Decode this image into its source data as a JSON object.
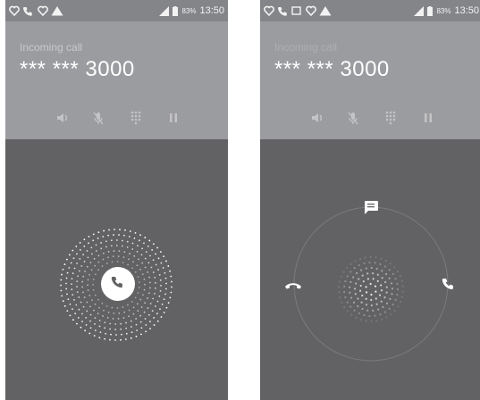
{
  "screens": [
    {
      "status_bar": {
        "battery": "83%",
        "time": "13:50"
      },
      "call": {
        "label": "Incoming call",
        "number": "*** *** 3000"
      }
    },
    {
      "status_bar": {
        "battery": "83%",
        "time": "13:50"
      },
      "call": {
        "label": "Incoming call",
        "number": "*** *** 3000"
      }
    }
  ],
  "icons": {
    "status_left_1": [
      "heart-icon",
      "phone-icon",
      "heart-icon",
      "warning-icon"
    ],
    "status_left_2": [
      "heart-icon",
      "phone-icon",
      "image-icon",
      "heart-icon",
      "warning-icon"
    ],
    "controls": [
      "speaker-icon",
      "mute-icon",
      "dialpad-icon",
      "hold-icon"
    ],
    "actions": [
      "message-icon",
      "decline-icon",
      "answer-icon"
    ]
  },
  "colors": {
    "header": "#9b9c9f",
    "status_bar": "#848589",
    "background": "#626264",
    "answer_button": "#ffffff"
  }
}
